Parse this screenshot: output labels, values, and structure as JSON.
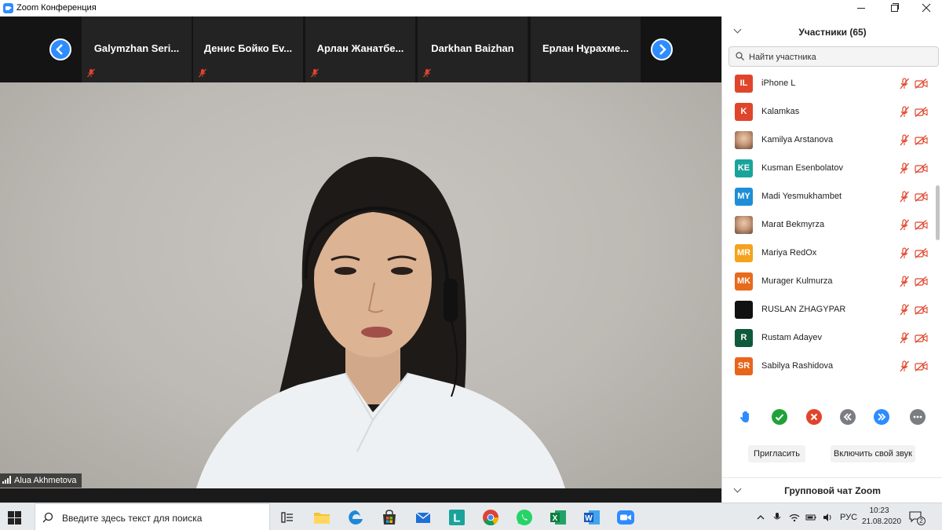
{
  "window": {
    "title": "Zoom Конференция"
  },
  "thumbnails": [
    {
      "name": "Galymzhan  Seri..."
    },
    {
      "name": "Денис Бойко Ev..."
    },
    {
      "name": "Арлан  Жанатбе..."
    },
    {
      "name": "Darkhan Baizhan"
    },
    {
      "name": "Ерлан Нұрахме..."
    }
  ],
  "main_video": {
    "speaker_name": "Alua Akhmetova"
  },
  "participants_panel": {
    "title": "Участники (65)",
    "search_placeholder": "Найти участника",
    "participants": [
      {
        "initials": "IL",
        "name": "iPhone L",
        "color": "#e0452b",
        "photo": false
      },
      {
        "initials": "K",
        "name": "Kalamkas",
        "color": "#e0452b",
        "photo": false
      },
      {
        "initials": "",
        "name": "Kamilya Arstanova",
        "color": "#d9a98a",
        "photo": true
      },
      {
        "initials": "KE",
        "name": "Kusman Esenbolatov",
        "color": "#1aa39a",
        "photo": false
      },
      {
        "initials": "MY",
        "name": "Madi Yesmukhambet",
        "color": "#1e8fd6",
        "photo": false
      },
      {
        "initials": "",
        "name": "Marat Bekmyrza",
        "color": "#8a7a70",
        "photo": true
      },
      {
        "initials": "MR",
        "name": "Mariya RedOx",
        "color": "#f5a21c",
        "photo": false
      },
      {
        "initials": "MK",
        "name": "Murager Kulmurza",
        "color": "#e86a1c",
        "photo": false
      },
      {
        "initials": "",
        "name": "RUSLAN ZHAGYPAR",
        "color": "#111111",
        "photo": false
      },
      {
        "initials": "R",
        "name": "Rustam Adayev",
        "color": "#0f5a3c",
        "photo": false
      },
      {
        "initials": "SR",
        "name": "Sabilya Rashidova",
        "color": "#e8651c",
        "photo": false
      }
    ],
    "invite_label": "Пригласить",
    "unmute_label": "Включить свой звук",
    "chat_title": "Групповой чат Zoom"
  },
  "taskbar": {
    "search_placeholder": "Введите здесь текст для поиска",
    "language": "РУС",
    "time": "10:23",
    "date": "21.08.2020",
    "notifications_count": "2"
  },
  "colors": {
    "accent": "#2d8cff",
    "mute_red": "#e0452b"
  }
}
